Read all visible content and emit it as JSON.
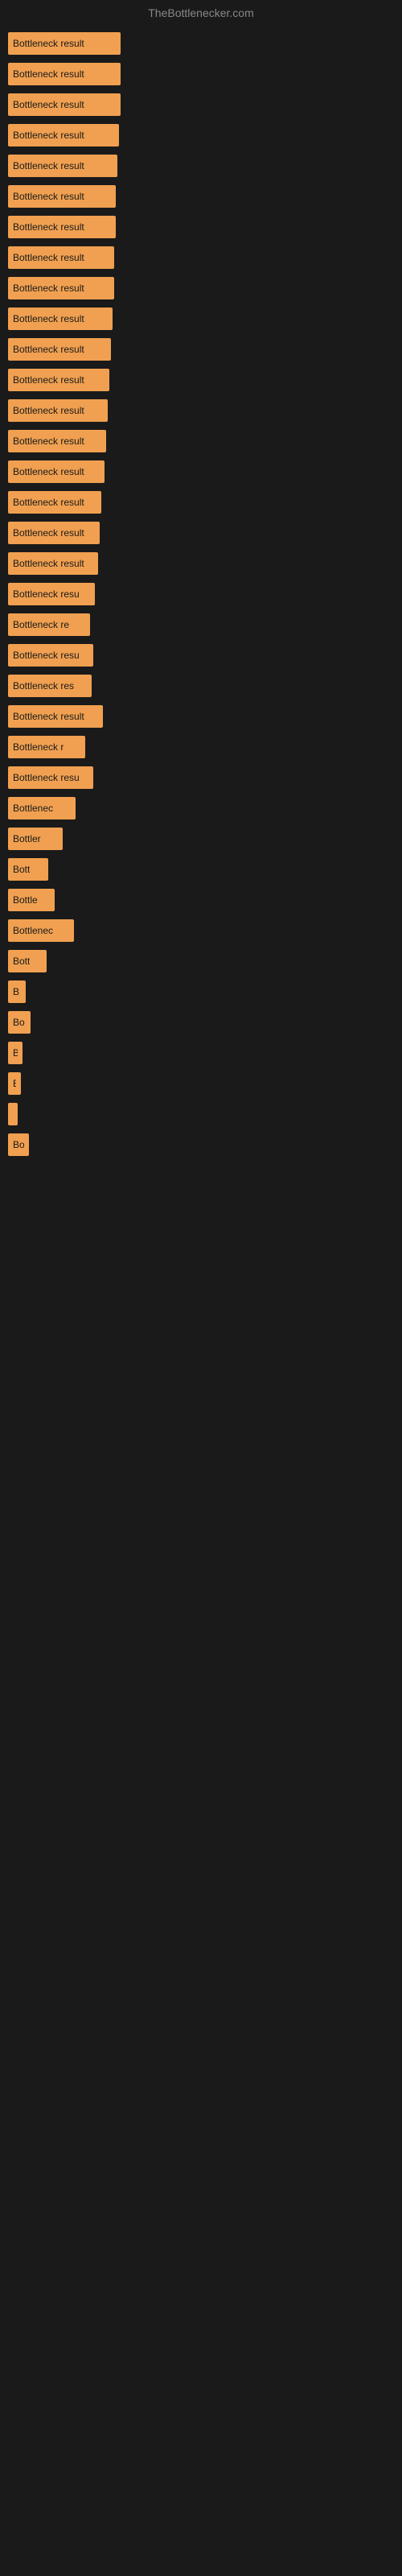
{
  "site": {
    "title": "TheBottlenecker.com"
  },
  "bars": [
    {
      "label": "Bottleneck result",
      "width": 140
    },
    {
      "label": "Bottleneck result",
      "width": 140
    },
    {
      "label": "Bottleneck result",
      "width": 140
    },
    {
      "label": "Bottleneck result",
      "width": 138
    },
    {
      "label": "Bottleneck result",
      "width": 136
    },
    {
      "label": "Bottleneck result",
      "width": 134
    },
    {
      "label": "Bottleneck result",
      "width": 134
    },
    {
      "label": "Bottleneck result",
      "width": 132
    },
    {
      "label": "Bottleneck result",
      "width": 132
    },
    {
      "label": "Bottleneck result",
      "width": 130
    },
    {
      "label": "Bottleneck result",
      "width": 128
    },
    {
      "label": "Bottleneck result",
      "width": 126
    },
    {
      "label": "Bottleneck result",
      "width": 124
    },
    {
      "label": "Bottleneck result",
      "width": 122
    },
    {
      "label": "Bottleneck result",
      "width": 120
    },
    {
      "label": "Bottleneck result",
      "width": 116
    },
    {
      "label": "Bottleneck result",
      "width": 114
    },
    {
      "label": "Bottleneck result",
      "width": 112
    },
    {
      "label": "Bottleneck resu",
      "width": 108
    },
    {
      "label": "Bottleneck re",
      "width": 102
    },
    {
      "label": "Bottleneck resu",
      "width": 106
    },
    {
      "label": "Bottleneck res",
      "width": 104
    },
    {
      "label": "Bottleneck result",
      "width": 118
    },
    {
      "label": "Bottleneck r",
      "width": 96
    },
    {
      "label": "Bottleneck resu",
      "width": 106
    },
    {
      "label": "Bottlenec",
      "width": 84
    },
    {
      "label": "Bottler",
      "width": 68
    },
    {
      "label": "Bott",
      "width": 50
    },
    {
      "label": "Bottle",
      "width": 58
    },
    {
      "label": "Bottlenec",
      "width": 82
    },
    {
      "label": "Bott",
      "width": 48
    },
    {
      "label": "B",
      "width": 22
    },
    {
      "label": "Bo",
      "width": 28
    },
    {
      "label": "B",
      "width": 18
    },
    {
      "label": "B",
      "width": 16
    },
    {
      "label": "I",
      "width": 10
    },
    {
      "label": "Bo",
      "width": 26
    }
  ]
}
